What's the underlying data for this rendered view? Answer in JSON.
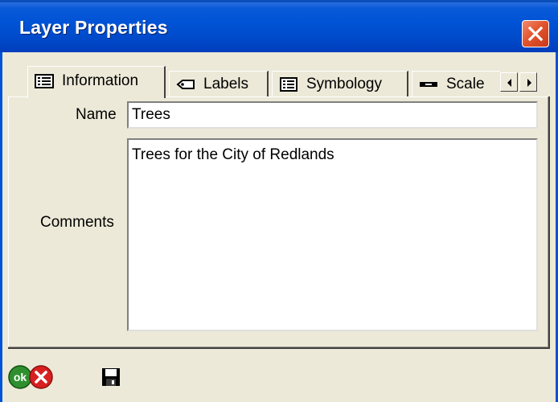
{
  "window": {
    "title": "Layer Properties"
  },
  "tabs": [
    {
      "label": "Information",
      "icon": "info-list-icon",
      "active": true
    },
    {
      "label": "Labels",
      "icon": "label-tag-icon",
      "active": false
    },
    {
      "label": "Symbology",
      "icon": "symbology-icon",
      "active": false
    },
    {
      "label": "Scale",
      "icon": "scale-bar-icon",
      "active": false
    }
  ],
  "form": {
    "name_label": "Name",
    "name_value": "Trees",
    "comments_label": "Comments",
    "comments_value": "Trees for the City of Redlands"
  },
  "buttons": {
    "ok_text": "ok"
  },
  "colors": {
    "titlebar": "#0053d6",
    "dialog_bg": "#ECE9D8",
    "close_button": "#e2552f",
    "ok_button": "#2f8f2f",
    "cancel_button": "#d82020"
  }
}
